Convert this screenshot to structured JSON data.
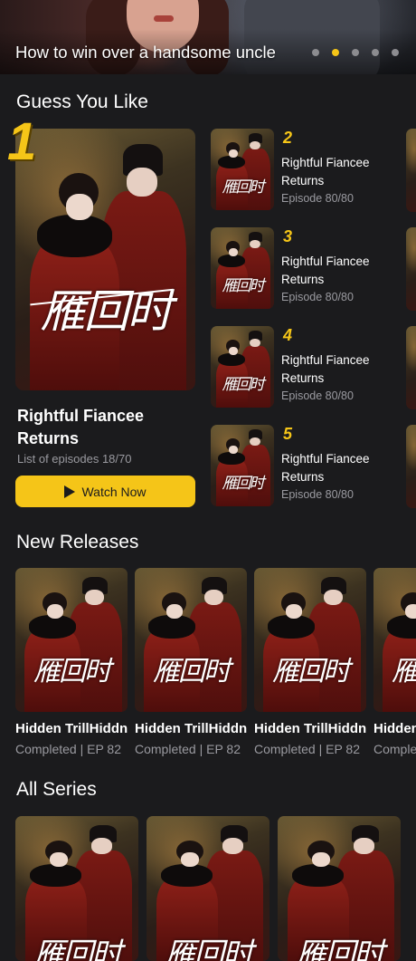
{
  "banner": {
    "title": "How to win over a handsome uncle",
    "slide_count": 5,
    "active_slide": 2
  },
  "colors": {
    "accent": "#f5c518",
    "background": "#1b1b1d",
    "muted_text": "#9a9aa0"
  },
  "poster_calligraphy": "雁回时",
  "guess_you_like": {
    "heading": "Guess You Like",
    "featured": {
      "rank": "1",
      "title": "Rightful Fiancee Returns",
      "episodes": "List of episodes 18/70",
      "button_label": "Watch Now",
      "button_icon": "play-icon"
    },
    "ranked": [
      {
        "rank": "2",
        "title": "Rightful Fiancee Returns",
        "episode": "Episode 80/80"
      },
      {
        "rank": "3",
        "title": "Rightful Fiancee Returns",
        "episode": "Episode 80/80"
      },
      {
        "rank": "4",
        "title": "Rightful Fiancee Returns",
        "episode": "Episode 80/80"
      },
      {
        "rank": "5",
        "title": "Rightful Fiancee Returns",
        "episode": "Episode 80/80"
      }
    ]
  },
  "new_releases": {
    "heading": "New Releases",
    "items": [
      {
        "title": "Hidden TrillHiddn",
        "status": "Completed | EP 82"
      },
      {
        "title": "Hidden TrillHiddn",
        "status": "Completed | EP 82"
      },
      {
        "title": "Hidden TrillHiddn",
        "status": "Completed | EP 82"
      },
      {
        "title": "Hidden",
        "status": "Comple"
      }
    ]
  },
  "all_series": {
    "heading": "All Series",
    "item_count": 3
  }
}
